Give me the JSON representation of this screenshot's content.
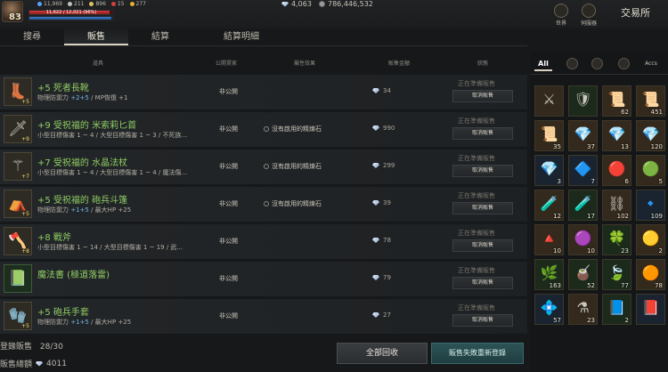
{
  "header": {
    "level": "83",
    "stats": [
      {
        "icon": "blue-gem-icon",
        "value": "11,969"
      },
      {
        "icon": "silver-icon",
        "value": "211"
      },
      {
        "icon": "clock-icon",
        "value": "896"
      },
      {
        "icon": "red-orb-icon",
        "value": "15"
      },
      {
        "icon": "gold-icon",
        "value": "277"
      }
    ],
    "hp_text": "11,622 / 12,021 (96%)",
    "hp_fraction": 0.96,
    "mp_fraction": 0.98,
    "diamonds": "4,063",
    "adena": "786,446,532",
    "world_label": "世界",
    "server_label": "伺服器",
    "title": "交易所"
  },
  "tabs": [
    "搜尋",
    "販售",
    "結算",
    "結算明細"
  ],
  "active_tab": 1,
  "columns": {
    "item": "道具",
    "visibility": "公開賣家",
    "attribute": "屬性效果",
    "price": "販售金額",
    "status": "狀態"
  },
  "rows": [
    {
      "name": "+5 死者長靴",
      "desc": "物理防禦力 ",
      "desc_hl": "+2+5",
      "desc_tail": " / MP恢復 +1",
      "visibility": "非公開",
      "attribute": "",
      "price": "34",
      "status": "正在準備販售",
      "button": "取消販售",
      "icon": "boots-icon",
      "enh": "+5"
    },
    {
      "name": "+9 受祝福的 米索莉匕首",
      "desc": "小型目標傷害 1 ~ 4 / 大型目標傷害 1 ~ 3 / 不死族...",
      "desc_hl": "",
      "desc_tail": "",
      "visibility": "非公開",
      "attribute": "沒有啟用的精煉石",
      "price": "990",
      "status": "正在準備販售",
      "button": "取消販售",
      "icon": "dagger-icon",
      "enh": "+9"
    },
    {
      "name": "+7 受祝福的 水晶法杖",
      "desc": "小型目標傷害 1 ~ 4 / 大型目標傷害 1 ~ 4 / 魔法傷...",
      "desc_hl": "",
      "desc_tail": "",
      "visibility": "非公開",
      "attribute": "沒有啟用的精煉石",
      "price": "299",
      "status": "正在準備販售",
      "button": "取消販售",
      "icon": "staff-icon",
      "enh": "+7"
    },
    {
      "name": "+5 受祝福的 砲兵斗篷",
      "desc": "物理防禦力 ",
      "desc_hl": "+1+5",
      "desc_tail": " / 最大HP +25",
      "visibility": "非公開",
      "attribute": "沒有啟用的精煉石",
      "price": "39",
      "status": "正在準備販售",
      "button": "取消販售",
      "icon": "cloak-icon",
      "enh": "+5"
    },
    {
      "name": "+8 戰斧",
      "desc": "小型目標傷害 1 ~ 14 / 大型目標傷害 1 ~ 19 / 武...",
      "desc_hl": "",
      "desc_tail": "",
      "visibility": "非公開",
      "attribute": "",
      "price": "78",
      "status": "正在準備販售",
      "button": "取消販售",
      "icon": "axe-icon",
      "enh": "+8"
    },
    {
      "name": "魔法書 (極道落雷)",
      "desc": "",
      "desc_hl": "",
      "desc_tail": "",
      "visibility": "非公開",
      "attribute": "",
      "price": "79",
      "status": "正在準備販售",
      "button": "取消販售",
      "icon": "spellbook-icon",
      "enh": ""
    },
    {
      "name": "+5 砲兵手套",
      "desc": "物理防禦力 ",
      "desc_hl": "+1+5",
      "desc_tail": " / 最大HP +25",
      "visibility": "非公開",
      "attribute": "",
      "price": "27",
      "status": "正在準備販售",
      "button": "取消販售",
      "icon": "gloves-icon",
      "enh": "+5"
    }
  ],
  "footer": {
    "registered_label": "登錄販售",
    "registered_value": "28/30",
    "total_label": "販售總額",
    "total_value": "4011",
    "collect_button": "全部回收",
    "reregister_button": "販售失敗重新登錄"
  },
  "inventory": {
    "filters": [
      "All",
      "helmet-filter-icon",
      "pouch-filter-icon",
      "scroll-filter-icon"
    ],
    "active_filter": "All",
    "extra_filter_label": "Accs",
    "items": [
      {
        "icon": "weapon-icon",
        "count": "",
        "tone": "tan"
      },
      {
        "icon": "armor-icon",
        "count": "",
        "tone": "green"
      },
      {
        "icon": "scroll-icon",
        "count": "62",
        "tone": "tan"
      },
      {
        "icon": "scroll-icon",
        "count": "451",
        "tone": "tan"
      },
      {
        "icon": "scroll-icon",
        "count": "35",
        "tone": "tan"
      },
      {
        "icon": "red-crystal-icon",
        "count": "37",
        "tone": "tan"
      },
      {
        "icon": "gold-crystal-icon",
        "count": "13",
        "tone": "tan"
      },
      {
        "icon": "green-crystal-icon",
        "count": "120",
        "tone": "tan"
      },
      {
        "icon": "blue-crystal-icon",
        "count": "3",
        "tone": "blue"
      },
      {
        "icon": "blue-gem-icon",
        "count": "7",
        "tone": "blue"
      },
      {
        "icon": "red-gem-icon",
        "count": "6",
        "tone": "tan"
      },
      {
        "icon": "green-gem-icon",
        "count": "5",
        "tone": "tan"
      },
      {
        "icon": "bottle-icon",
        "count": "12",
        "tone": "tan"
      },
      {
        "icon": "green-bottle-icon",
        "count": "17",
        "tone": "green"
      },
      {
        "icon": "silver-ore-icon",
        "count": "102",
        "tone": "tan"
      },
      {
        "icon": "blue-ore-icon",
        "count": "109",
        "tone": "blue"
      },
      {
        "icon": "red-ore-icon",
        "count": "10",
        "tone": "tan"
      },
      {
        "icon": "purple-ore-icon",
        "count": "10",
        "tone": "tan"
      },
      {
        "icon": "green-ore-icon",
        "count": "23",
        "tone": "green"
      },
      {
        "icon": "gold-ore-icon",
        "count": "2",
        "tone": "tan"
      },
      {
        "icon": "herb-icon",
        "count": "163",
        "tone": "green"
      },
      {
        "icon": "green-potion-icon",
        "count": "52",
        "tone": "green"
      },
      {
        "icon": "leaf-icon",
        "count": "77",
        "tone": "green"
      },
      {
        "icon": "orange-orb-icon",
        "count": "78",
        "tone": "tan"
      },
      {
        "icon": "blue-shard-icon",
        "count": "57",
        "tone": "blue"
      },
      {
        "icon": "red-potion-icon",
        "count": "23",
        "tone": "tan"
      },
      {
        "icon": "book-icon",
        "count": "2",
        "tone": "green"
      },
      {
        "icon": "blue-book-icon",
        "count": "",
        "tone": "blue"
      }
    ]
  },
  "colors": {
    "item_name": "#8fcc64",
    "highlight": "#6fb6e8",
    "accent_button": "#2d5356"
  }
}
